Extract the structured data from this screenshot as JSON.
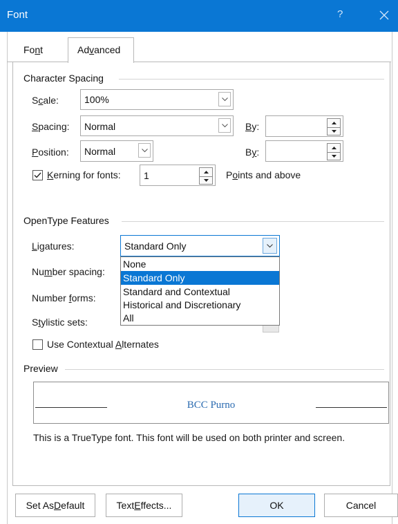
{
  "window": {
    "title": "Font",
    "help_glyph": "?",
    "close_icon": "close-icon"
  },
  "tabs": [
    {
      "label_pre": "Fo",
      "label_mnemonic": "n",
      "label_post": "t",
      "active": false
    },
    {
      "label_pre": "Ad",
      "label_mnemonic": "v",
      "label_post": "anced",
      "active": true
    }
  ],
  "character_spacing": {
    "heading": "Character Spacing",
    "scale": {
      "label_pre": "S",
      "label_mnemonic": "c",
      "label_post": "ale:",
      "value": "100%"
    },
    "spacing": {
      "label_pre": "",
      "label_mnemonic": "S",
      "label_post": "pacing:",
      "value": "Normal",
      "by_pre": "",
      "by_mnemonic": "B",
      "by_post": "y:",
      "by_value": ""
    },
    "position": {
      "label_pre": "",
      "label_mnemonic": "P",
      "label_post": "osition:",
      "value": "Normal",
      "by_pre": "B",
      "by_mnemonic": "y",
      "by_post": ":",
      "by_value": ""
    },
    "kerning": {
      "checked": true,
      "label_pre": "",
      "label_mnemonic": "K",
      "label_post": "erning for fonts:",
      "value": "1",
      "suffix_pre": "P",
      "suffix_mnemonic": "o",
      "suffix_post": "ints and above"
    }
  },
  "opentype": {
    "heading": "OpenType Features",
    "ligatures": {
      "label_pre": "",
      "label_mnemonic": "L",
      "label_post": "igatures:",
      "value": "Standard Only"
    },
    "number_spacing": {
      "label_pre": "Nu",
      "label_mnemonic": "m",
      "label_post": "ber spacing:"
    },
    "number_forms": {
      "label_pre": "Number ",
      "label_mnemonic": "f",
      "label_post": "orms:"
    },
    "stylistic_sets": {
      "label_pre": "S",
      "label_mnemonic": "t",
      "label_post": "ylistic sets:"
    },
    "contextual": {
      "checked": false,
      "label_pre": "Use Contextual ",
      "label_mnemonic": "A",
      "label_post": "lternates"
    },
    "dropdown_options": [
      "None",
      "Standard Only",
      "Standard and Contextual",
      "Historical and Discretionary",
      "All"
    ],
    "selected_index": 1
  },
  "preview": {
    "heading": "Preview",
    "sample": "BCC Purno",
    "description": "This is a TrueType font. This font will be used on both printer and screen."
  },
  "buttons": {
    "set_default_pre": "Set As ",
    "set_default_mnemonic": "D",
    "set_default_post": "efault",
    "text_effects_pre": "Text ",
    "text_effects_mnemonic": "E",
    "text_effects_post": "ffects...",
    "ok": "OK",
    "cancel": "Cancel"
  },
  "colors": {
    "titlebar": "#0a77d4",
    "selection": "#0a77d4",
    "preview_text": "#2a6ab0"
  }
}
